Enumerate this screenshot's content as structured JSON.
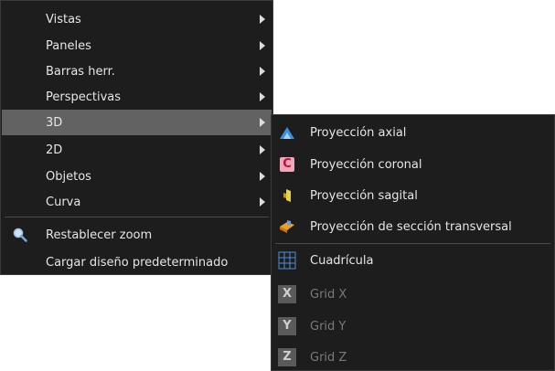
{
  "main_menu": {
    "items": [
      {
        "label": "Vistas",
        "submenu": true
      },
      {
        "label": "Paneles",
        "submenu": true
      },
      {
        "label": "Barras herr.",
        "submenu": true
      },
      {
        "label": "Perspectivas",
        "submenu": true
      },
      {
        "label": "3D",
        "submenu": true,
        "highlighted": true
      },
      {
        "label": "2D",
        "submenu": true
      },
      {
        "label": "Objetos",
        "submenu": true
      },
      {
        "label": "Curva",
        "submenu": true
      },
      {
        "label": "Restablecer zoom",
        "icon": "magnifier-icon"
      },
      {
        "label": "Cargar diseño predeterminado"
      }
    ]
  },
  "sub_menu_3d": {
    "items": [
      {
        "label": "Proyección axial",
        "icon": "axial-projection-icon"
      },
      {
        "label": "Proyección coronal",
        "icon": "coronal-projection-icon",
        "icon_letter": "C"
      },
      {
        "label": "Proyección sagital",
        "icon": "sagittal-projection-icon"
      },
      {
        "label": "Proyección de sección transversal",
        "icon": "cross-section-projection-icon"
      },
      {
        "label": "Cuadrícula",
        "icon": "grid-icon"
      },
      {
        "label": "Grid X",
        "icon": "grid-x-icon",
        "icon_letter": "X",
        "disabled": true
      },
      {
        "label": "Grid Y",
        "icon": "grid-y-icon",
        "icon_letter": "Y",
        "disabled": true
      },
      {
        "label": "Grid Z",
        "icon": "grid-z-icon",
        "icon_letter": "Z",
        "disabled": true
      }
    ]
  },
  "colors": {
    "menu_bg": "#1d1d1d",
    "highlight_bg": "#626262",
    "text": "#e6e6e6",
    "disabled_text": "#7a7a7a"
  }
}
